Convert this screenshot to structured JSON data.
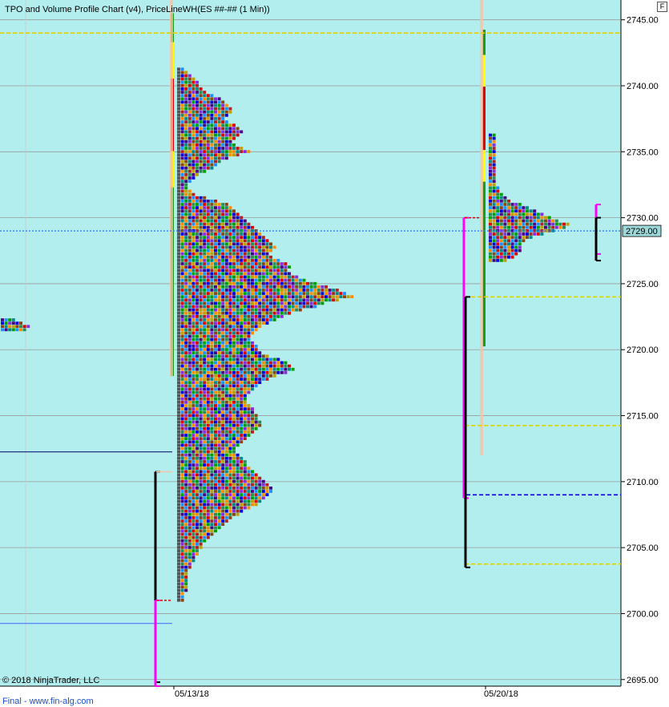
{
  "chart_title": "TPO and Volume Profile Chart (v4), PriceLineWH(ES ##-## (1 Min))",
  "copyright": "© 2018 NinjaTrader, LLC",
  "footer": "Final - www.fin-alg.com",
  "corner_button": "F",
  "colors": {
    "background": "#b3eeee",
    "axis_bg": "#ffffff",
    "gridline": "#9a9a9a",
    "price_dotted": "#2f7dff",
    "poc_dashed": "#e0d000",
    "va_blue": "#0000e0",
    "marker_magenta": "#ff00ff",
    "tpo_palette": [
      "#e00000",
      "#0000e0",
      "#00a000",
      "#8a2be2",
      "#ff8c00",
      "#008b8b",
      "#8b4513",
      "#c0a000",
      "#4b0082",
      "#2e8b57",
      "#b22222",
      "#1e90ff"
    ]
  },
  "chart_data": {
    "type": "tpo-profile",
    "y_axis": {
      "min": 2694.5,
      "max": 2746.5,
      "ticks": [
        "2745.00",
        "2740.00",
        "2735.00",
        "2730.00",
        "2725.00",
        "2720.00",
        "2715.00",
        "2710.00",
        "2705.00",
        "2700.00",
        "2695.00"
      ],
      "tick_values": [
        2745,
        2740,
        2735,
        2730,
        2725,
        2720,
        2715,
        2710,
        2705,
        2700,
        2695
      ]
    },
    "x_axis": {
      "labels": [
        "05/13/18",
        "05/20/18"
      ]
    },
    "current_price_label": "2729.00",
    "current_price": 2729.0,
    "horizontal_levels": {
      "poc_lines": [
        2744.0,
        2724.0,
        2714.25,
        2703.75
      ],
      "value_area_line": 2709.0,
      "left_reference_lines": [
        2712.25,
        2699.25
      ]
    },
    "sessions": [
      {
        "label": "05/13/18",
        "price_min": 2701.0,
        "price_max": 2741.25,
        "poc": 2724.0,
        "value_area_high": 2730.0,
        "value_area_low": 2709.0,
        "tpo_widths": [
          [
            2741.25,
            2
          ],
          [
            2741,
            3
          ],
          [
            2740.75,
            4
          ],
          [
            2740.5,
            5
          ],
          [
            2740.25,
            6
          ],
          [
            2740,
            6
          ],
          [
            2739.75,
            7
          ],
          [
            2739.5,
            8
          ],
          [
            2739.25,
            10
          ],
          [
            2739,
            12
          ],
          [
            2738.75,
            13
          ],
          [
            2738.5,
            14
          ],
          [
            2738.25,
            15
          ],
          [
            2738,
            15
          ],
          [
            2737.75,
            14
          ],
          [
            2737.5,
            13
          ],
          [
            2737.25,
            14
          ],
          [
            2737,
            16
          ],
          [
            2736.75,
            17
          ],
          [
            2736.5,
            18
          ],
          [
            2736.25,
            17
          ],
          [
            2736,
            16
          ],
          [
            2735.75,
            15
          ],
          [
            2735.5,
            16
          ],
          [
            2735.25,
            18
          ],
          [
            2735,
            20
          ],
          [
            2734.75,
            17
          ],
          [
            2734.5,
            14
          ],
          [
            2734.25,
            12
          ],
          [
            2734,
            11
          ],
          [
            2733.75,
            10
          ],
          [
            2733.5,
            8
          ],
          [
            2733.25,
            6
          ],
          [
            2733,
            5
          ],
          [
            2732.75,
            4
          ],
          [
            2732.5,
            3
          ],
          [
            2732.25,
            3
          ],
          [
            2732,
            4
          ],
          [
            2731.75,
            5
          ],
          [
            2731.5,
            8
          ],
          [
            2731.25,
            11
          ],
          [
            2731,
            14
          ],
          [
            2730.75,
            15
          ],
          [
            2730.5,
            16
          ],
          [
            2730.25,
            17
          ],
          [
            2730,
            18
          ],
          [
            2729.75,
            19
          ],
          [
            2729.5,
            20
          ],
          [
            2729.25,
            21
          ],
          [
            2729,
            22
          ],
          [
            2728.75,
            23
          ],
          [
            2728.5,
            24
          ],
          [
            2728.25,
            25
          ],
          [
            2728,
            26
          ],
          [
            2727.75,
            27
          ],
          [
            2727.5,
            26
          ],
          [
            2727.25,
            25
          ],
          [
            2727,
            26
          ],
          [
            2726.75,
            28
          ],
          [
            2726.5,
            30
          ],
          [
            2726.25,
            31
          ],
          [
            2726,
            30
          ],
          [
            2725.75,
            31
          ],
          [
            2725.5,
            33
          ],
          [
            2725.25,
            35
          ],
          [
            2725,
            38
          ],
          [
            2724.75,
            41
          ],
          [
            2724.5,
            44
          ],
          [
            2724.25,
            46
          ],
          [
            2724,
            48
          ],
          [
            2723.75,
            44
          ],
          [
            2723.5,
            40
          ],
          [
            2723.25,
            38
          ],
          [
            2723,
            34
          ],
          [
            2722.75,
            31
          ],
          [
            2722.5,
            29
          ],
          [
            2722.25,
            27
          ],
          [
            2722,
            25
          ],
          [
            2721.75,
            23
          ],
          [
            2721.5,
            22
          ],
          [
            2721.25,
            21
          ],
          [
            2721,
            20
          ],
          [
            2720.75,
            20
          ],
          [
            2720.5,
            21
          ],
          [
            2720.25,
            22
          ],
          [
            2720,
            22
          ],
          [
            2719.75,
            23
          ],
          [
            2719.5,
            25
          ],
          [
            2719.25,
            28
          ],
          [
            2719,
            30
          ],
          [
            2718.75,
            31
          ],
          [
            2718.5,
            32
          ],
          [
            2718.25,
            30
          ],
          [
            2718,
            27
          ],
          [
            2717.75,
            25
          ],
          [
            2717.5,
            23
          ],
          [
            2717.25,
            22
          ],
          [
            2717,
            21
          ],
          [
            2716.75,
            20
          ],
          [
            2716.5,
            19
          ],
          [
            2716.25,
            19
          ],
          [
            2716,
            19
          ],
          [
            2715.75,
            20
          ],
          [
            2715.5,
            21
          ],
          [
            2715.25,
            21
          ],
          [
            2715,
            22
          ],
          [
            2714.75,
            22
          ],
          [
            2714.5,
            23
          ],
          [
            2714.25,
            23
          ],
          [
            2714,
            22
          ],
          [
            2713.75,
            21
          ],
          [
            2713.5,
            20
          ],
          [
            2713.25,
            19
          ],
          [
            2713,
            18
          ],
          [
            2712.75,
            17
          ],
          [
            2712.5,
            16
          ],
          [
            2712.25,
            16
          ],
          [
            2712,
            17
          ],
          [
            2711.75,
            18
          ],
          [
            2711.5,
            19
          ],
          [
            2711.25,
            19
          ],
          [
            2711,
            20
          ],
          [
            2710.75,
            21
          ],
          [
            2710.5,
            22
          ],
          [
            2710.25,
            23
          ],
          [
            2710,
            24
          ],
          [
            2709.75,
            25
          ],
          [
            2709.5,
            26
          ],
          [
            2709.25,
            26
          ],
          [
            2709,
            25
          ],
          [
            2708.75,
            24
          ],
          [
            2708.5,
            23
          ],
          [
            2708.25,
            22
          ],
          [
            2708,
            20
          ],
          [
            2707.75,
            18
          ],
          [
            2707.5,
            17
          ],
          [
            2707.25,
            15
          ],
          [
            2707,
            14
          ],
          [
            2706.75,
            13
          ],
          [
            2706.5,
            12
          ],
          [
            2706.25,
            11
          ],
          [
            2706,
            10
          ],
          [
            2705.75,
            9
          ],
          [
            2705.5,
            8
          ],
          [
            2705.25,
            7
          ],
          [
            2705,
            7
          ],
          [
            2704.75,
            6
          ],
          [
            2704.5,
            6
          ],
          [
            2704.25,
            5
          ],
          [
            2704,
            5
          ],
          [
            2703.75,
            4
          ],
          [
            2703.5,
            4
          ],
          [
            2703.25,
            3
          ],
          [
            2703,
            3
          ],
          [
            2702.75,
            3
          ],
          [
            2702.5,
            3
          ],
          [
            2702.25,
            3
          ],
          [
            2702,
            3
          ],
          [
            2701.75,
            3
          ],
          [
            2701.5,
            2
          ],
          [
            2701.25,
            2
          ],
          [
            2701,
            2
          ]
        ]
      },
      {
        "label": "05/20/18",
        "price_min": 2726.75,
        "price_max": 2736.25,
        "poc": 2729.5,
        "value_area_high": 2730.25,
        "value_area_low": 2723.75,
        "tpo_widths": [
          [
            2736.25,
            2
          ],
          [
            2736,
            2
          ],
          [
            2735.75,
            2
          ],
          [
            2735.5,
            2
          ],
          [
            2735.25,
            2
          ],
          [
            2735,
            2
          ],
          [
            2734.75,
            2
          ],
          [
            2734.5,
            2
          ],
          [
            2734.25,
            2
          ],
          [
            2734,
            2
          ],
          [
            2733.75,
            2
          ],
          [
            2733.5,
            2
          ],
          [
            2733.25,
            2
          ],
          [
            2733,
            2
          ],
          [
            2732.75,
            2
          ],
          [
            2732.5,
            2
          ],
          [
            2732.25,
            3
          ],
          [
            2732,
            3
          ],
          [
            2731.75,
            4
          ],
          [
            2731.5,
            5
          ],
          [
            2731.25,
            6
          ],
          [
            2731,
            9
          ],
          [
            2730.75,
            11
          ],
          [
            2730.5,
            13
          ],
          [
            2730.25,
            15
          ],
          [
            2730,
            17
          ],
          [
            2729.75,
            19
          ],
          [
            2729.5,
            22
          ],
          [
            2729.25,
            21
          ],
          [
            2729,
            18
          ],
          [
            2728.75,
            15
          ],
          [
            2728.5,
            12
          ],
          [
            2728.25,
            10
          ],
          [
            2728,
            9
          ],
          [
            2727.75,
            9
          ],
          [
            2727.5,
            9
          ],
          [
            2727.25,
            8
          ],
          [
            2727,
            7
          ],
          [
            2726.75,
            5
          ]
        ]
      }
    ],
    "left_stub_rows": [
      [
        2722.25,
        4
      ],
      [
        2722,
        6
      ],
      [
        2721.75,
        8
      ],
      [
        2721.5,
        7
      ]
    ]
  }
}
